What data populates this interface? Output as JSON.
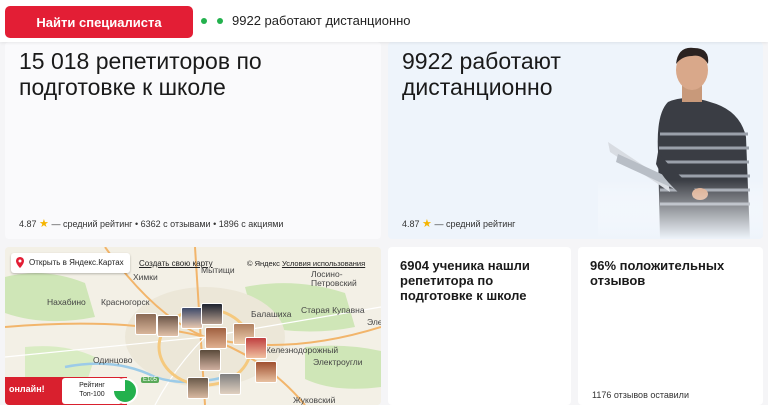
{
  "topbar": {
    "find_button": "Найти специалиста",
    "status": "9922 работают дистанционно"
  },
  "cards": {
    "tutors": {
      "title_line1": "15 018 репетиторов по",
      "title_line2": "подготовке к школе",
      "rating": "4.87",
      "meta_rest": "— средний рейтинг • 6362 с отзывами • 1896 с акциями"
    },
    "remote": {
      "title_line1": "9922 работают",
      "title_line2": "дистанционно",
      "rating": "4.87",
      "meta_rest": "— средний рейтинг"
    },
    "map": {
      "open_label": "Открыть в Яндекс.Картах",
      "create_link": "Создать свою карту",
      "copyright": "© Яндекс",
      "terms_link": "Условия использования",
      "places": [
        "Химки",
        "Мытищи",
        "Лосино-Петровский",
        "Нахабино",
        "Красногорск",
        "Балашиха",
        "Старая Купавна",
        "Электроугли",
        "Железнодорожный",
        "Одинцово",
        "Жуковский",
        "Эле"
      ],
      "road": "E105",
      "online_label": "онлайн!",
      "badge_line1": "Рейтинг",
      "badge_line2": "Топ-100"
    },
    "students": {
      "title": "6904 ученика нашли репетитора по подготовке к школе"
    },
    "reviews": {
      "title": "96% положительных отзывов",
      "footnote": "1176 отзывов оставили"
    }
  },
  "icons": [
    "star-icon",
    "map-pin-icon",
    "avatar-photo",
    "person-with-laptop"
  ],
  "colors": {
    "brand_red": "#e31e35",
    "online_green": "#23b14d",
    "star": "#f5b400"
  }
}
